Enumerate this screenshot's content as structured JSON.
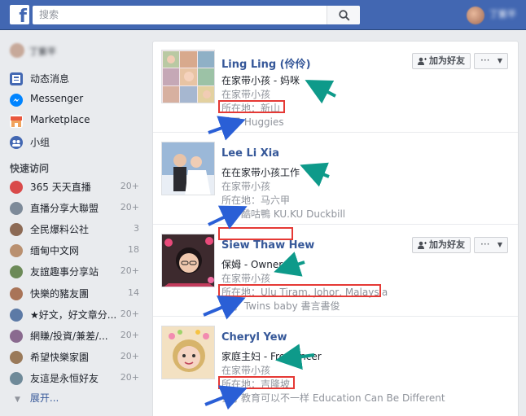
{
  "topbar": {
    "logo": "f",
    "search_placeholder": "搜索",
    "user_name": "丁紫平"
  },
  "leftnav": {
    "me_name": "丁紫平",
    "items": [
      {
        "label": "动态消息",
        "icon": "news-feed-icon",
        "color": "#4267b2"
      },
      {
        "label": "Messenger",
        "icon": "messenger-icon",
        "color": "#0084ff"
      },
      {
        "label": "Marketplace",
        "icon": "marketplace-icon",
        "color": "#e9573e"
      },
      {
        "label": "小组",
        "icon": "groups-icon",
        "color": "#4267b2"
      }
    ],
    "shortcuts_title": "快速访问",
    "shortcuts": [
      {
        "label": "365 天天直播",
        "count": "20+"
      },
      {
        "label": "直播分享大聯盟",
        "count": "20+"
      },
      {
        "label": "全民爆料公社",
        "count": "3"
      },
      {
        "label": "缅甸中文网",
        "count": "18"
      },
      {
        "label": "友誼趣事分享站",
        "count": "20+"
      },
      {
        "label": "快樂的豬友團",
        "count": "14"
      },
      {
        "label": "★好文，好文章分...",
        "count": "20+"
      },
      {
        "label": "網賺/投資/兼差/...",
        "count": "20+"
      },
      {
        "label": "希望快樂家園",
        "count": "20+"
      },
      {
        "label": "友這是永恒好友",
        "count": "20+"
      }
    ],
    "more_label": "展开..."
  },
  "friends": [
    {
      "name": "Ling Ling (伶伶)",
      "line1": "在家带小孩 - 妈咪",
      "line2": "在家带小孩",
      "line3": "所在地：新山",
      "line4": "赞了 Huggies",
      "has_button": true
    },
    {
      "name": "Lee Li Xia",
      "line1": "在在家带小孩工作",
      "line2": "在家带小孩",
      "line3": "所在地：马六甲",
      "line4": "赞了酷咕鴨 KU.KU Duckbill",
      "has_button": false
    },
    {
      "name": "Siew Thaw Hew",
      "line1": "保姆 - Owner",
      "line2": "在家带小孩",
      "line3": "所在地：Ulu Tiram, Johor, Malaysia",
      "line4": "赞了 Twins baby 書言書俊",
      "has_button": true
    },
    {
      "name": "Cheryl Yew",
      "line1": "家庭主妇 - Freelancer",
      "line2": "在家带小孩",
      "line3": "所在地：吉隆坡",
      "line4": "赞了教育可以不一样 Education Can Be Different",
      "has_button": false
    }
  ],
  "buttons": {
    "add_friend": "加为好友",
    "more": "···"
  },
  "colors": {
    "brand": "#4267b2",
    "link": "#365899",
    "highlight_box": "#e53935",
    "arrow_teal": "#0e9a8a",
    "arrow_blue": "#2a5fd6"
  }
}
